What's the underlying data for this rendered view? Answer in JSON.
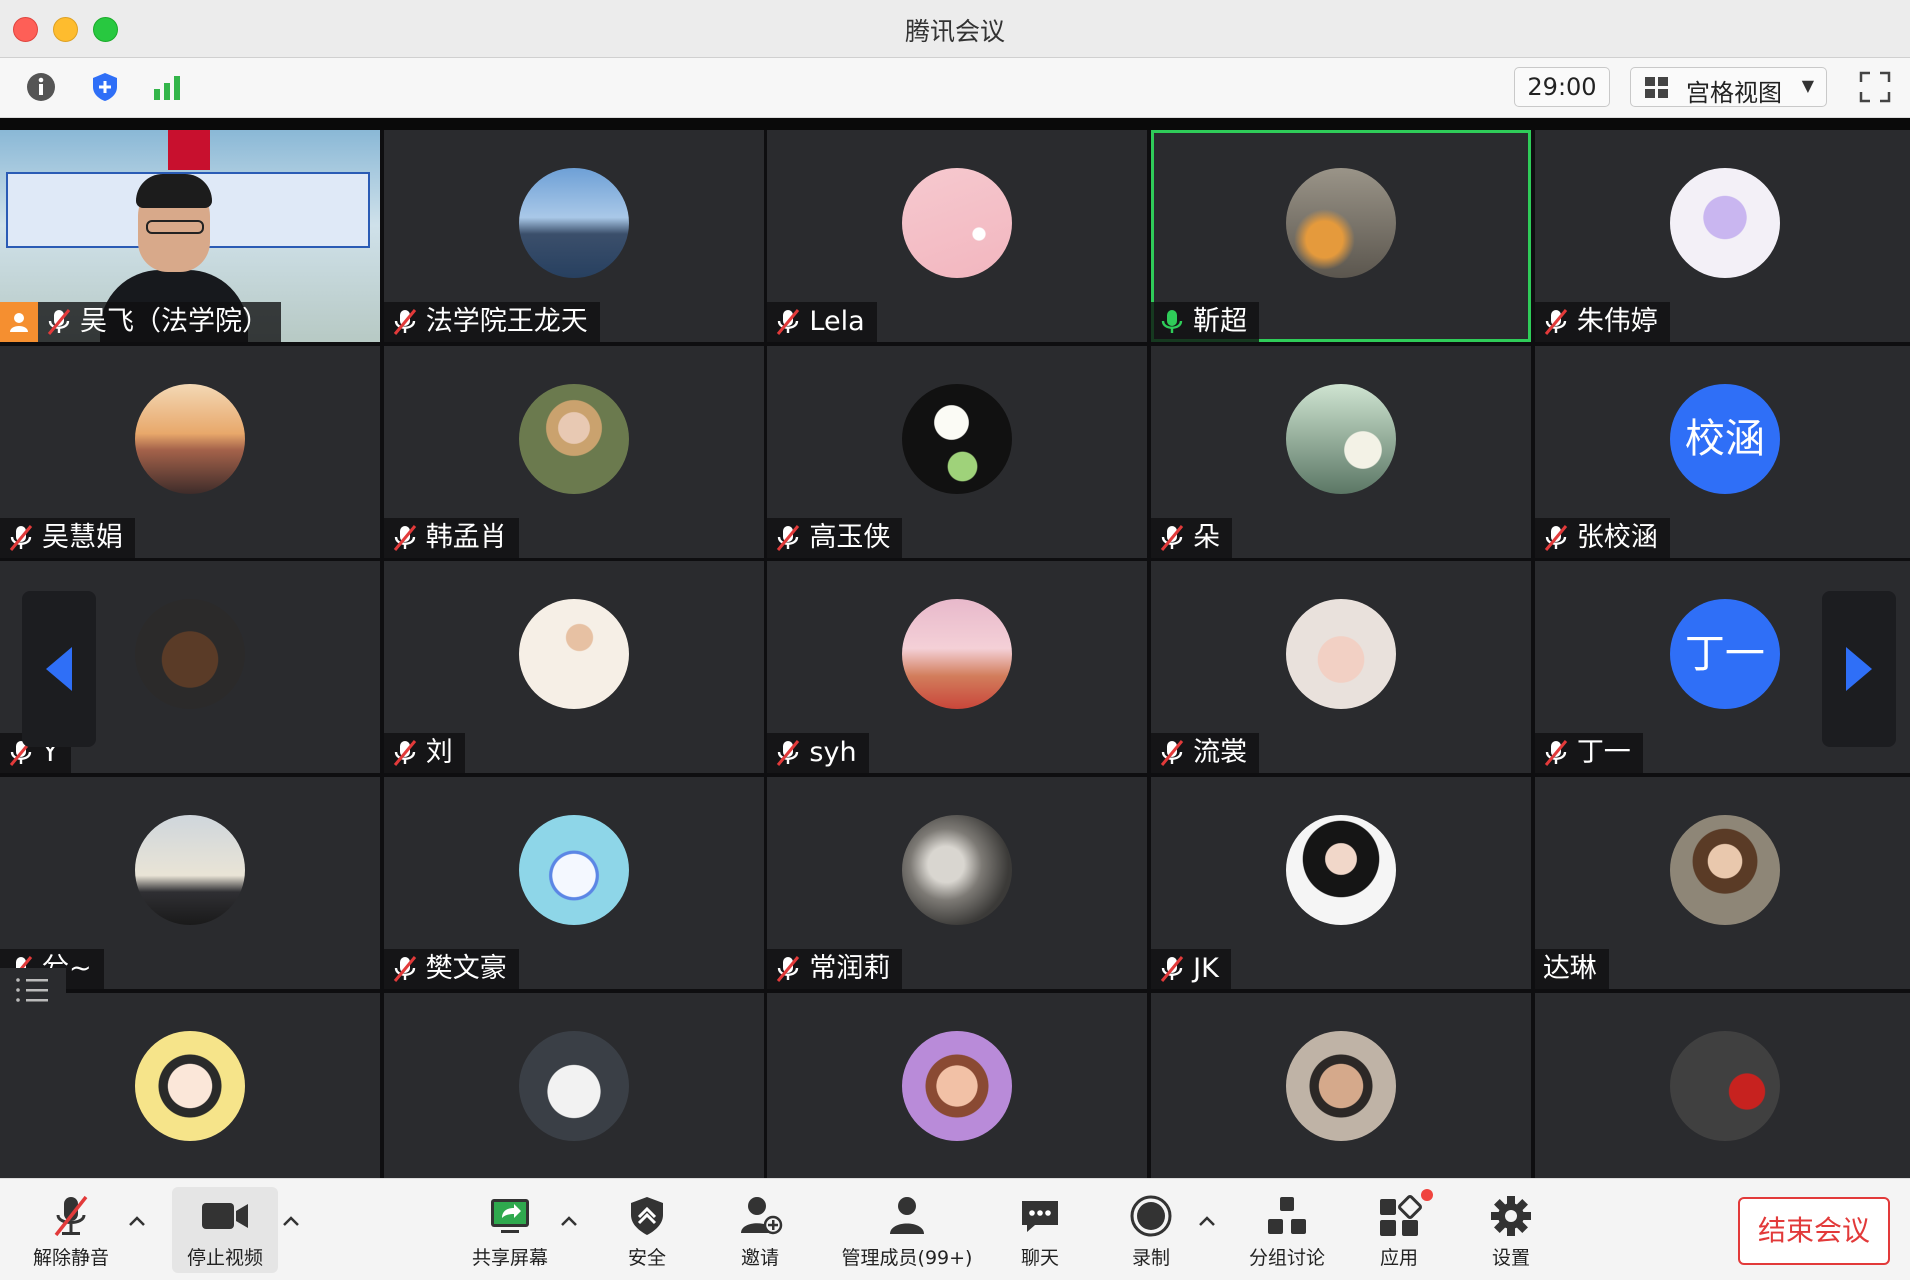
{
  "window": {
    "title": "腾讯会议"
  },
  "toolbar": {
    "timer": "29:00",
    "view_label": "宫格视图"
  },
  "participants": [
    {
      "name": "吴飞（法学院）",
      "avatar": "video-feed",
      "muted": true,
      "host": true
    },
    {
      "name": "法学院王龙天",
      "avatar": "city-skyline",
      "muted": true
    },
    {
      "name": "Lela",
      "avatar": "pink-sky",
      "muted": true
    },
    {
      "name": "靳超",
      "avatar": "soldier-photo",
      "muted": false,
      "speaking": true
    },
    {
      "name": "朱伟婷",
      "avatar": "stellalou-bunny",
      "muted": true
    },
    {
      "name": "吴慧娟",
      "avatar": "sunset-beach",
      "muted": true
    },
    {
      "name": "韩孟肖",
      "avatar": "girl-portrait",
      "muted": true
    },
    {
      "name": "高玉侠",
      "avatar": "white-flowers",
      "muted": true
    },
    {
      "name": "朵",
      "avatar": "girl-with-bouquet",
      "muted": true
    },
    {
      "name": "张校涵",
      "avatar_text": "校涵",
      "muted": true
    },
    {
      "name": "Y",
      "avatar": "teddy-bear",
      "muted": true
    },
    {
      "name": "刘",
      "avatar": "girl-collage",
      "muted": true
    },
    {
      "name": "syh",
      "avatar": "castle-scene",
      "muted": true
    },
    {
      "name": "流裳",
      "avatar": "girl-heart-hands",
      "muted": true
    },
    {
      "name": "丁一",
      "avatar_text": "丁一",
      "muted": true
    },
    {
      "name": "兮~",
      "avatar": "silhouette-sky",
      "muted": true
    },
    {
      "name": "樊文豪",
      "avatar": "cartoon-box",
      "muted": true
    },
    {
      "name": "常润莉",
      "avatar": "vintage-photo",
      "muted": true
    },
    {
      "name": "JK",
      "avatar": "anime-girl",
      "muted": true
    },
    {
      "name": "达琳",
      "avatar": "smiling-girl",
      "muted": false,
      "no_mic_icon": true
    },
    {
      "name": "",
      "avatar": "cartoon-girl",
      "partial": true
    },
    {
      "name": "",
      "avatar": "white-cat",
      "partial": true
    },
    {
      "name": "",
      "avatar": "anna-cartoon",
      "partial": true
    },
    {
      "name": "",
      "avatar": "laughing-man",
      "partial": true
    },
    {
      "name": "",
      "avatar": "red-doll-sign",
      "partial": true
    }
  ],
  "bottombar": {
    "unmute": "解除静音",
    "stop_video": "停止视频",
    "share_screen": "共享屏幕",
    "security": "安全",
    "invite": "邀请",
    "manage_members": "管理成员(99+)",
    "chat": "聊天",
    "record": "录制",
    "breakout": "分组讨论",
    "apps": "应用",
    "settings": "设置",
    "end_meeting": "结束会议"
  },
  "colors": {
    "speaking": "#2fcc59",
    "end": "#e23a3a",
    "text_avatar": "#2f6ff7",
    "host_badge": "#f58f30"
  }
}
